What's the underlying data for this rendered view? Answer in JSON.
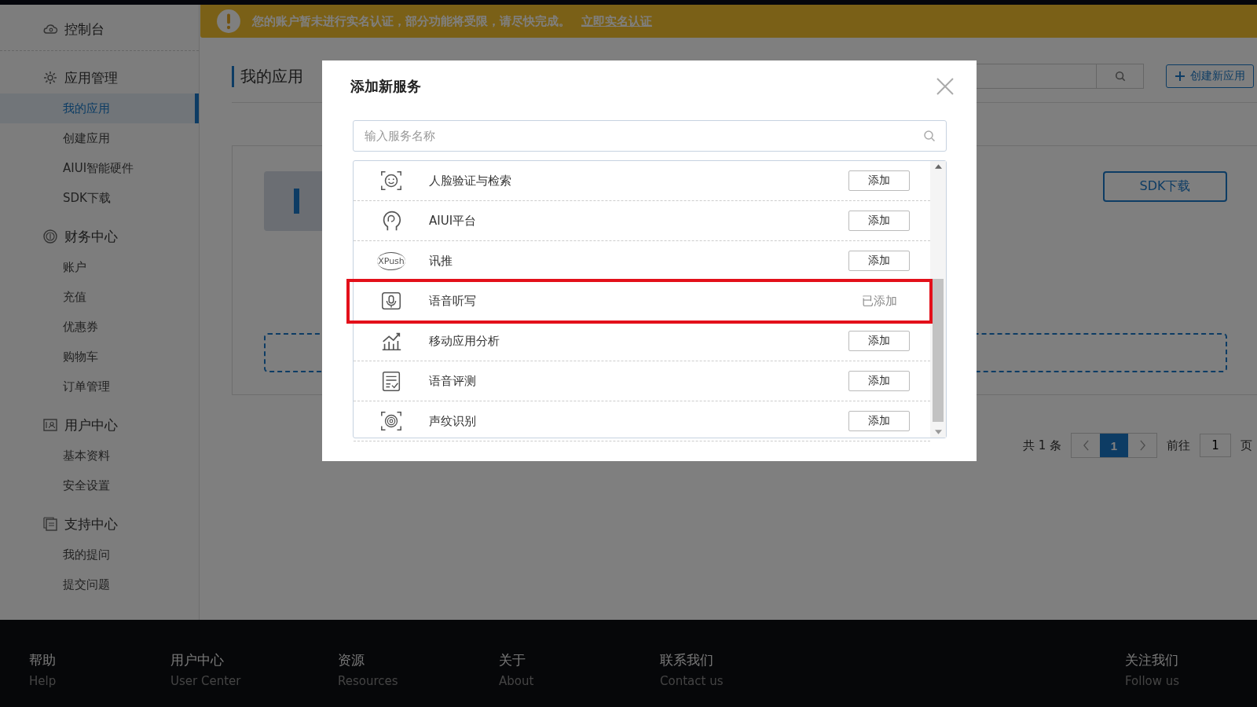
{
  "sidebar": {
    "top": {
      "label": "控制台"
    },
    "groups": [
      {
        "title": "应用管理",
        "items": [
          {
            "label": "我的应用",
            "selected": true
          },
          {
            "label": "创建应用",
            "selected": false
          },
          {
            "label": "AIUI智能硬件",
            "selected": false
          },
          {
            "label": "SDK下载",
            "selected": false
          }
        ]
      },
      {
        "title": "财务中心",
        "items": [
          {
            "label": "账户",
            "selected": false
          },
          {
            "label": "充值",
            "selected": false
          },
          {
            "label": "优惠券",
            "selected": false
          },
          {
            "label": "购物车",
            "selected": false
          },
          {
            "label": "订单管理",
            "selected": false
          }
        ]
      },
      {
        "title": "用户中心",
        "items": [
          {
            "label": "基本资料",
            "selected": false
          },
          {
            "label": "安全设置",
            "selected": false
          }
        ]
      },
      {
        "title": "支持中心",
        "items": [
          {
            "label": "我的提问",
            "selected": false
          },
          {
            "label": "提交问题",
            "selected": false
          }
        ]
      }
    ]
  },
  "banner": {
    "message": "您的账户暂未进行实名认证，部分功能将受限，请尽快完成。",
    "link": "立即实名认证"
  },
  "page": {
    "title": "我的应用",
    "create_button": "创建新应用",
    "sdk_button": "SDK下载"
  },
  "pagination": {
    "total": "共 1 条",
    "pages": [
      {
        "label": "1",
        "selected": true
      }
    ],
    "goto_label": "前往",
    "goto_value": "1",
    "page_unit": "页"
  },
  "modal": {
    "title": "添加新服务",
    "search": {
      "placeholder": "输入服务名称"
    },
    "services": [
      {
        "name": "人脸验证与检索",
        "added": false,
        "highlighted": false,
        "action": "添加"
      },
      {
        "name": "AIUI平台",
        "added": false,
        "highlighted": false,
        "action": "添加"
      },
      {
        "name": "讯推",
        "added": false,
        "highlighted": false,
        "action": "添加",
        "logo_text": "XPush"
      },
      {
        "name": "语音听写",
        "added": true,
        "highlighted": true,
        "action": "已添加"
      },
      {
        "name": "移动应用分析",
        "added": false,
        "highlighted": false,
        "action": "添加"
      },
      {
        "name": "语音评测",
        "added": false,
        "highlighted": false,
        "action": "添加"
      },
      {
        "name": "声纹识别",
        "added": false,
        "highlighted": false,
        "action": "添加"
      }
    ]
  },
  "footer": {
    "columns": [
      {
        "title": "帮助",
        "subtitle": "Help"
      },
      {
        "title": "用户中心",
        "subtitle": "User Center"
      },
      {
        "title": "资源",
        "subtitle": "Resources"
      },
      {
        "title": "关于",
        "subtitle": "About"
      },
      {
        "title": "联系我们",
        "subtitle": "Contact us"
      }
    ],
    "follow": {
      "title": "关注我们",
      "subtitle": "Follow us"
    }
  }
}
